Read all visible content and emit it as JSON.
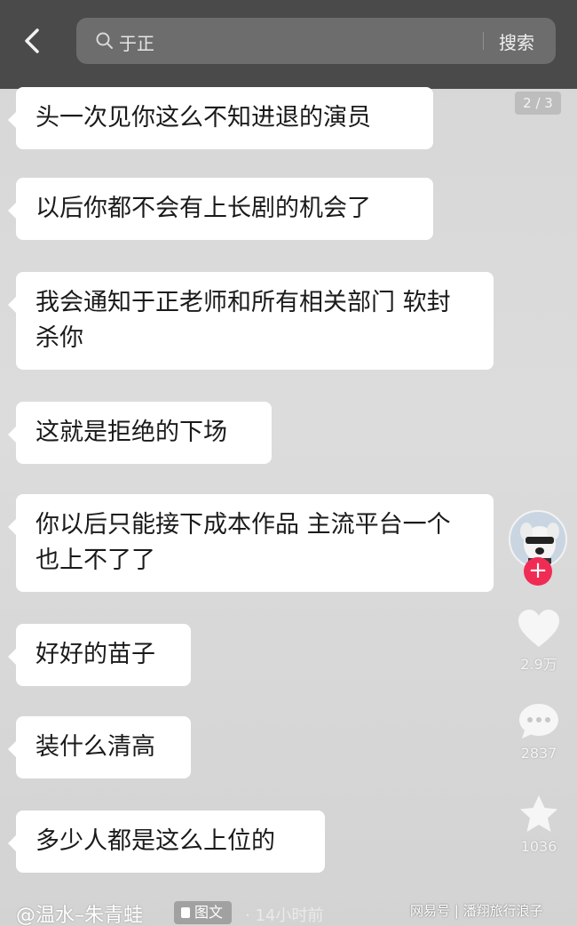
{
  "search": {
    "query": "于正",
    "submit_label": "搜索"
  },
  "page_indicator": "2 / 3",
  "messages": [
    "头一次见你这么不知进退的演员",
    "以后你都不会有上长剧的机会了",
    "我会通知于正老师和所有相关部门 软封杀你",
    "这就是拒绝的下场",
    "你以后只能接下成本作品 主流平台一个也上不了了",
    "好好的苗子",
    "装什么清高",
    "多少人都是这么上位的"
  ],
  "sidebar": {
    "follow_symbol": "+",
    "likes": "2.9万",
    "comments": "2837",
    "favorites": "1036"
  },
  "footer": {
    "author": "@温水–朱青蛙",
    "post_type": "图文",
    "time_ago": "· 14小时前",
    "watermark": "网易号 | 潘翔旅行浪子"
  },
  "colors": {
    "top_bar": "#4a4a4a",
    "bubble": "#ffffff",
    "follow": "#f02c55"
  }
}
